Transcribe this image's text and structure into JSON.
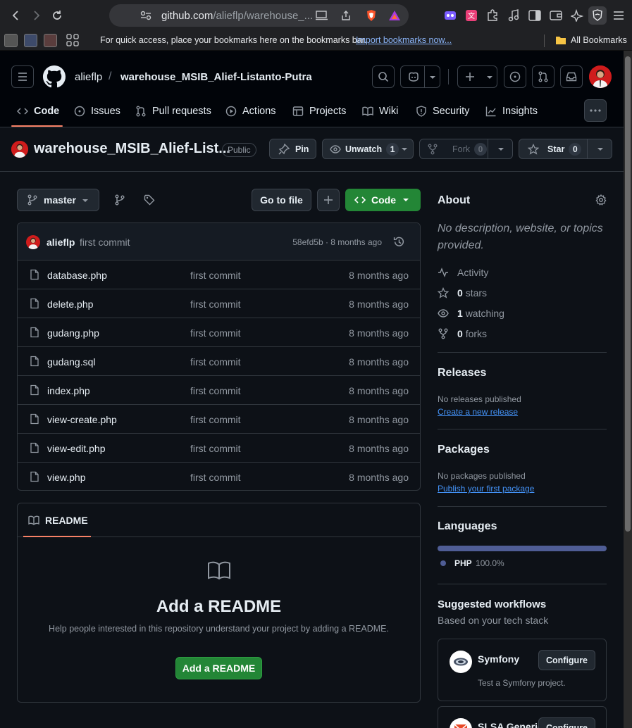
{
  "browser": {
    "url_host": "github.com",
    "url_path": "/alieflp/warehouse_...",
    "bookmarks_hint": "For quick access, place your bookmarks here on the bookmarks bar.",
    "bookmarks_import": "Import bookmarks now...",
    "all_bookmarks": "All Bookmarks"
  },
  "header": {
    "owner": "alieflp",
    "separator": "/",
    "repo": "warehouse_MSIB_Alief-Listanto-Putra"
  },
  "nav": {
    "tabs": [
      {
        "label": "Code",
        "icon": "code-icon",
        "active": true
      },
      {
        "label": "Issues",
        "icon": "issue-icon"
      },
      {
        "label": "Pull requests",
        "icon": "pull-request-icon"
      },
      {
        "label": "Actions",
        "icon": "play-icon"
      },
      {
        "label": "Projects",
        "icon": "table-icon"
      },
      {
        "label": "Wiki",
        "icon": "book-icon"
      },
      {
        "label": "Security",
        "icon": "shield-icon"
      },
      {
        "label": "Insights",
        "icon": "graph-icon"
      }
    ]
  },
  "repo": {
    "title": "warehouse_MSIB_Alief-List...",
    "visibility": "Public",
    "pin_label": "Pin",
    "unwatch_label": "Unwatch",
    "watch_count": "1",
    "fork_label": "Fork",
    "fork_count": "0",
    "star_label": "Star",
    "star_count": "0"
  },
  "toolbar": {
    "branch": "master",
    "go_to_file": "Go to file",
    "code_label": "Code"
  },
  "commit": {
    "author": "alieflp",
    "message": "first commit",
    "hash_time": "58efd5b · 8 months ago"
  },
  "files": [
    {
      "name": "database.php",
      "message": "first commit",
      "age": "8 months ago"
    },
    {
      "name": "delete.php",
      "message": "first commit",
      "age": "8 months ago"
    },
    {
      "name": "gudang.php",
      "message": "first commit",
      "age": "8 months ago"
    },
    {
      "name": "gudang.sql",
      "message": "first commit",
      "age": "8 months ago"
    },
    {
      "name": "index.php",
      "message": "first commit",
      "age": "8 months ago"
    },
    {
      "name": "view-create.php",
      "message": "first commit",
      "age": "8 months ago"
    },
    {
      "name": "view-edit.php",
      "message": "first commit",
      "age": "8 months ago"
    },
    {
      "name": "view.php",
      "message": "first commit",
      "age": "8 months ago"
    }
  ],
  "readme": {
    "tab_label": "README",
    "heading": "Add a README",
    "description": "Help people interested in this repository understand your project by adding a README.",
    "button": "Add a README"
  },
  "about": {
    "title": "About",
    "description": "No description, website, or topics provided.",
    "activity": "Activity",
    "stars_count": "0",
    "stars_label": "stars",
    "watching_count": "1",
    "watching_label": "watching",
    "forks_count": "0",
    "forks_label": "forks"
  },
  "releases": {
    "title": "Releases",
    "none": "No releases published",
    "link": "Create a new release"
  },
  "packages": {
    "title": "Packages",
    "none": "No packages published",
    "link": "Publish your first package"
  },
  "languages": {
    "title": "Languages",
    "items": [
      {
        "name": "PHP",
        "percent": "100.0%",
        "color": "#4F5D95"
      }
    ]
  },
  "workflows": {
    "title": "Suggested workflows",
    "subtitle": "Based on your tech stack",
    "items": [
      {
        "name": "Symfony",
        "description": "Test a Symfony project.",
        "button": "Configure"
      },
      {
        "name": "SLSA Generic",
        "button": "Configure"
      }
    ]
  },
  "colors": {
    "accent_green": "#238636",
    "tab_underline": "#f78166",
    "link_blue": "#4493f8",
    "background": "#0d1117"
  }
}
